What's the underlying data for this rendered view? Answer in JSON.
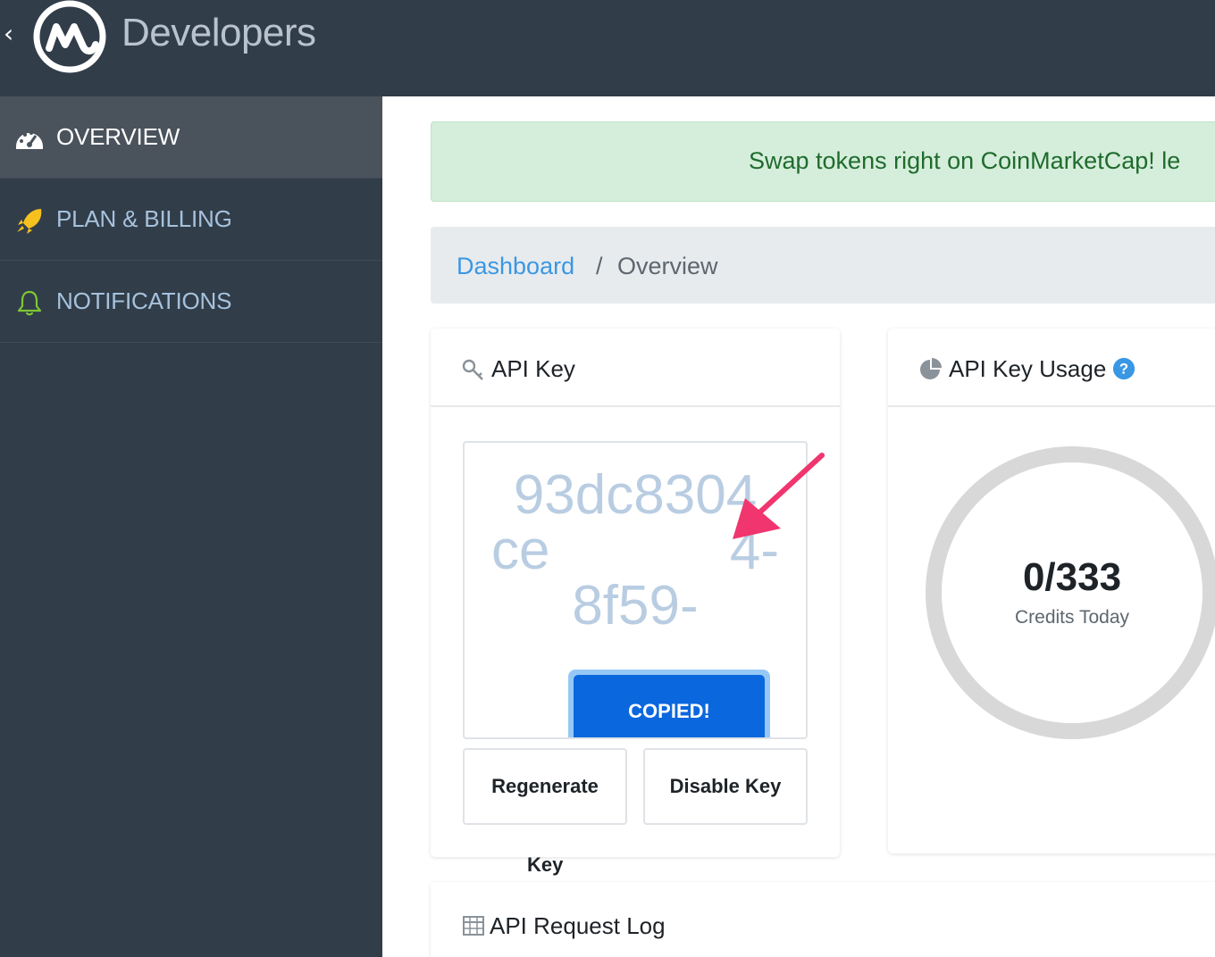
{
  "header": {
    "back_icon": "chevron-left-icon",
    "brand_name": "Developers"
  },
  "sidebar": {
    "items": [
      {
        "label": "OVERVIEW",
        "icon": "dashboard-gauge-icon",
        "active": true
      },
      {
        "label": "PLAN & BILLING",
        "icon": "rocket-icon",
        "active": false
      },
      {
        "label": "NOTIFICATIONS",
        "icon": "bell-icon",
        "active": false
      }
    ]
  },
  "banner": {
    "text": "Swap tokens right on CoinMarketCap! le"
  },
  "breadcrumb": {
    "link": "Dashboard",
    "separator": "/",
    "current": "Overview"
  },
  "api_key_card": {
    "title": "API Key",
    "key_lines": [
      "93dc8304",
      "ce",
      "4-",
      "8f59-"
    ],
    "copied_label": "COPIED!",
    "regenerate_label": "Regenerate",
    "disable_label": "Disable Key",
    "footer_text": "Key"
  },
  "usage_card": {
    "title": "API Key Usage",
    "value": "0/333",
    "label": "Credits Today"
  },
  "log_card": {
    "title": "API Request Log"
  },
  "colors": {
    "header_bg": "#323d4a",
    "accent_blue": "#0b67dd",
    "link_blue": "#3a97e4",
    "banner_green": "#d5eedb",
    "arrow_pink": "#f0356f"
  }
}
